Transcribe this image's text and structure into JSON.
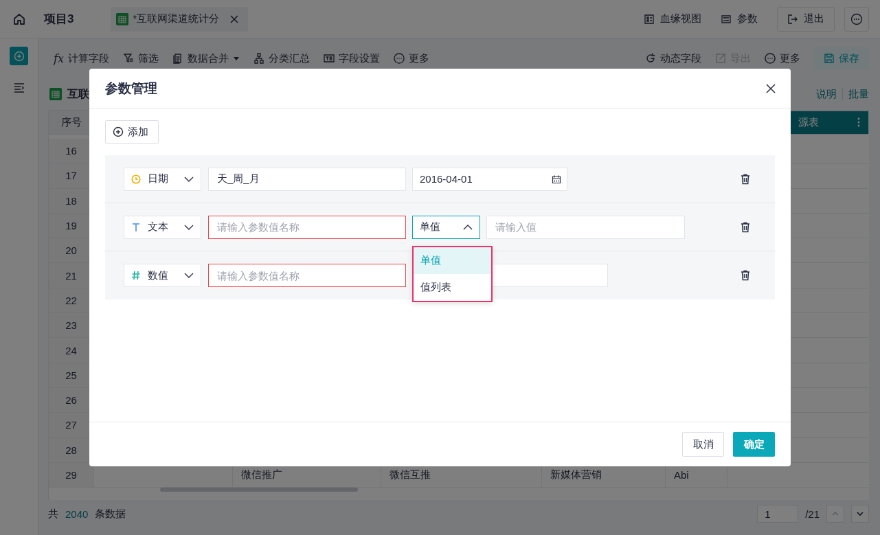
{
  "topbar": {
    "project": "项目3",
    "tab": {
      "label": "*互联网渠道统计分"
    },
    "actions": [
      {
        "label": "血缘视图"
      },
      {
        "label": "参数"
      }
    ],
    "exit": "退出"
  },
  "toolbar_left": [
    {
      "label": "计算字段",
      "prefix": "fx",
      "caret": false
    },
    {
      "label": "筛选",
      "caret": false
    },
    {
      "label": "数据合并",
      "caret": true
    },
    {
      "label": "分类汇总",
      "caret": false
    },
    {
      "label": "字段设置",
      "caret": false
    },
    {
      "label": "更多",
      "caret": false
    }
  ],
  "toolbar_right": [
    {
      "label": "动态字段",
      "disabled": false,
      "primary": false
    },
    {
      "label": "导出",
      "disabled": true,
      "primary": false
    },
    {
      "label": "更多",
      "disabled": false,
      "primary": false
    },
    {
      "label": "保存",
      "disabled": false,
      "primary": true
    }
  ],
  "table": {
    "title": "互联",
    "links": [
      "说明",
      "批量"
    ],
    "source_tab": "源表",
    "columns": [
      "序号"
    ],
    "rows": [
      [
        "16"
      ],
      [
        "17"
      ],
      [
        "18"
      ],
      [
        "19"
      ],
      [
        "20"
      ],
      [
        "21"
      ],
      [
        "22"
      ],
      [
        "23"
      ],
      [
        "24"
      ],
      [
        "25"
      ],
      [
        "26"
      ],
      [
        "27"
      ],
      [
        "28"
      ],
      [
        "29",
        "",
        "微信推广",
        "微信互推",
        "新媒体营销",
        "Abi"
      ]
    ]
  },
  "footer": {
    "prefix": "共",
    "count": "2040",
    "suffix": "条数据",
    "page": "1",
    "pages": "/21"
  },
  "dialog": {
    "title": "参数管理",
    "add": "添加",
    "params": [
      {
        "kind": "date",
        "type_label": "日期",
        "name": "天_周_月",
        "error": false,
        "value": "2016-04-01"
      },
      {
        "kind": "text",
        "type_label": "文本",
        "name_placeholder": "请输入参数值名称",
        "error": true,
        "mode": "单值",
        "mode_open": true,
        "value_placeholder": "请输入值"
      },
      {
        "kind": "number",
        "type_label": "数值",
        "name_placeholder": "请输入参数值名称",
        "error": true
      }
    ],
    "mode_options": [
      {
        "label": "单值",
        "selected": true
      },
      {
        "label": "值列表",
        "selected": false
      }
    ],
    "cancel": "取消",
    "confirm": "确定"
  }
}
